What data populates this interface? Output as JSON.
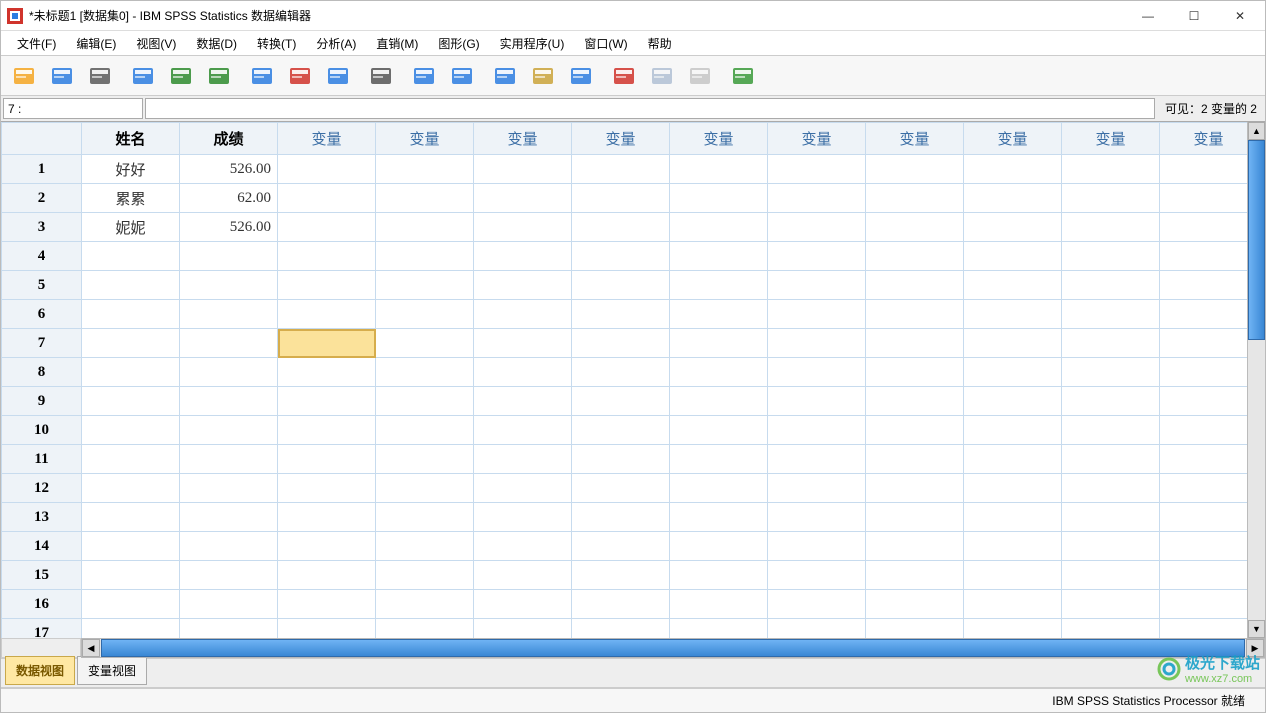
{
  "window": {
    "title": "*未标题1 [数据集0] - IBM SPSS Statistics 数据编辑器",
    "min": "—",
    "max": "☐",
    "close": "✕"
  },
  "menu": [
    "文件(F)",
    "编辑(E)",
    "视图(V)",
    "数据(D)",
    "转换(T)",
    "分析(A)",
    "直销(M)",
    "图形(G)",
    "实用程序(U)",
    "窗口(W)",
    "帮助"
  ],
  "toolbar_icons": [
    {
      "n": "open-icon",
      "c": "#f5a623"
    },
    {
      "n": "save-icon",
      "c": "#2b7de1"
    },
    {
      "n": "print-icon",
      "c": "#5b5b5b"
    },
    {
      "n": "sep"
    },
    {
      "n": "recall-dialog-icon",
      "c": "#2b7de1"
    },
    {
      "n": "undo-icon",
      "c": "#2e8b2e"
    },
    {
      "n": "redo-icon",
      "c": "#2e8b2e"
    },
    {
      "n": "sep"
    },
    {
      "n": "goto-case-icon",
      "c": "#2b7de1"
    },
    {
      "n": "goto-var-icon",
      "c": "#d0342c"
    },
    {
      "n": "variables-icon",
      "c": "#2b7de1"
    },
    {
      "n": "sep"
    },
    {
      "n": "find-icon",
      "c": "#555"
    },
    {
      "n": "sep"
    },
    {
      "n": "insert-case-icon",
      "c": "#2b7de1"
    },
    {
      "n": "insert-var-icon",
      "c": "#2b7de1"
    },
    {
      "n": "sep"
    },
    {
      "n": "split-icon",
      "c": "#2b7de1"
    },
    {
      "n": "weight-icon",
      "c": "#caa33a"
    },
    {
      "n": "select-cases-icon",
      "c": "#2b7de1"
    },
    {
      "n": "sep"
    },
    {
      "n": "value-labels-icon",
      "c": "#d0342c"
    },
    {
      "n": "use-sets-icon",
      "c": "#5a7ba8",
      "dis": true
    },
    {
      "n": "show-all-icon",
      "c": "#888",
      "dis": true
    },
    {
      "n": "sep"
    },
    {
      "n": "spellcheck-icon",
      "c": "#3a9a3a"
    }
  ],
  "cellbar": {
    "ref": "7 :",
    "value": "",
    "visible": "可见：2 变量的 2"
  },
  "columns": {
    "defined": [
      "姓名",
      "成绩"
    ],
    "placeholder": "变量",
    "extra_count": 13
  },
  "rows": [
    {
      "n": 1,
      "name": "好好",
      "score": "526.00"
    },
    {
      "n": 2,
      "name": "累累",
      "score": "62.00"
    },
    {
      "n": 3,
      "name": "妮妮",
      "score": "526.00"
    }
  ],
  "blank_rows": 14,
  "active_cell": {
    "row": 7,
    "col": 3
  },
  "tabs": {
    "data": "数据视图",
    "var": "变量视图",
    "active": "data"
  },
  "status": "IBM SPSS Statistics Processor 就绪",
  "watermark": {
    "brand": "极光下载站",
    "url": "www.xz7.com"
  }
}
